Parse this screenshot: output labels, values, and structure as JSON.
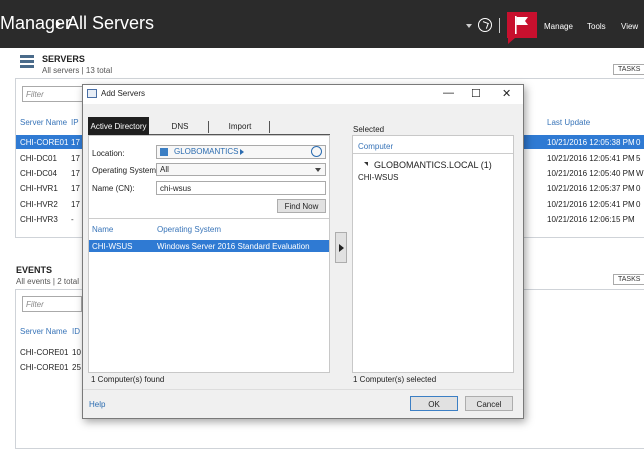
{
  "window": {
    "title_prefix": "Manager",
    "view_title": "All Servers"
  },
  "menu": {
    "manage": "Manage",
    "tools": "Tools",
    "view": "View"
  },
  "servers": {
    "heading": "SERVERS",
    "subtitle": "All servers | 13 total",
    "tasks": "TASKS",
    "filter_placeholder": "Filter",
    "columns": [
      "Server Name",
      "IP",
      "Last Update"
    ],
    "rows": [
      {
        "name": "CHI-CORE01",
        "ip": "17",
        "last_update": "10/21/2016 12:05:38 PM",
        "extra": "0"
      },
      {
        "name": "CHI-DC01",
        "ip": "17",
        "last_update": "10/21/2016 12:05:41 PM",
        "extra": "5"
      },
      {
        "name": "CHI-DC04",
        "ip": "17",
        "last_update": "10/21/2016 12:05:40 PM",
        "extra": "W"
      },
      {
        "name": "CHI-HVR1",
        "ip": "17",
        "last_update": "10/21/2016 12:05:37 PM",
        "extra": "0"
      },
      {
        "name": "CHI-HVR2",
        "ip": "17",
        "last_update": "10/21/2016 12:05:41 PM",
        "extra": "0"
      },
      {
        "name": "CHI-HVR3",
        "ip": "-",
        "last_update": "10/21/2016 12:06:15 PM",
        "extra": ""
      }
    ]
  },
  "events": {
    "heading": "EVENTS",
    "subtitle": "All events | 2 total",
    "tasks": "TASKS",
    "filter_placeholder": "Filter",
    "columns": [
      "Server Name",
      "ID"
    ],
    "rows": [
      {
        "name": "CHI-CORE01",
        "id": "10"
      },
      {
        "name": "CHI-CORE01",
        "id": "25"
      }
    ]
  },
  "dialog": {
    "title": "Add Servers",
    "controls": {
      "minimize": "—",
      "maximize": "☐",
      "close": "✕"
    },
    "tabs": [
      "Active Directory",
      "DNS",
      "Import"
    ],
    "location_label": "Location:",
    "location_value": "GLOBOMANTICS",
    "os_label": "Operating System:",
    "os_value": "All",
    "name_label": "Name (CN):",
    "name_value": "chi-wsus",
    "find_now": "Find Now",
    "results_columns": [
      "Name",
      "Operating System"
    ],
    "results": [
      {
        "name": "CHI-WSUS",
        "os": "Windows Server 2016 Standard Evaluation"
      }
    ],
    "found_count": "1 Computer(s) found",
    "selected_label": "Selected",
    "selected_column": "Computer",
    "selected_group": "GLOBOMANTICS.LOCAL (1)",
    "selected_items": [
      "CHI-WSUS"
    ],
    "selected_count": "1 Computer(s) selected",
    "help": "Help",
    "ok": "OK",
    "cancel": "Cancel"
  },
  "colors": {
    "accent": "#2f7ad3",
    "titlebar": "#2b2b2b",
    "notification_flag": "#c8102e",
    "link": "#2b6cb0"
  }
}
